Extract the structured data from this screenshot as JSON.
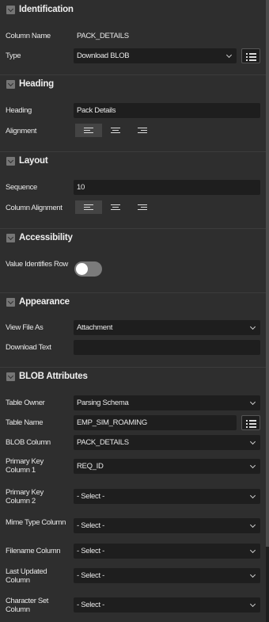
{
  "sections": {
    "identification": "Identification",
    "heading": "Heading",
    "layout": "Layout",
    "accessibility": "Accessibility",
    "appearance": "Appearance",
    "blob": "BLOB Attributes"
  },
  "identification": {
    "column_name_label": "Column Name",
    "column_name_value": "PACK_DETAILS",
    "type_label": "Type",
    "type_value": "Download BLOB"
  },
  "heading": {
    "heading_label": "Heading",
    "heading_value": "Pack Details",
    "alignment_label": "Alignment",
    "alignment_selected": "left"
  },
  "layout": {
    "sequence_label": "Sequence",
    "sequence_value": "10",
    "column_alignment_label": "Column Alignment",
    "column_alignment_selected": "left"
  },
  "accessibility": {
    "value_identifies_row_label": "Value Identifies Row",
    "value_identifies_row_on": false
  },
  "appearance": {
    "view_file_as_label": "View File As",
    "view_file_as_value": "Attachment",
    "download_text_label": "Download Text",
    "download_text_value": ""
  },
  "blob": {
    "table_owner_label": "Table Owner",
    "table_owner_value": "Parsing Schema",
    "table_name_label": "Table Name",
    "table_name_value": "EMP_SIM_ROAMING",
    "blob_column_label": "BLOB Column",
    "blob_column_value": "PACK_DETAILS",
    "pk1_label": "Primary Key Column 1",
    "pk1_value": "REQ_ID",
    "pk2_label": "Primary Key Column 2",
    "pk2_value": "- Select -",
    "mime_label": "Mime Type Column",
    "mime_value": "- Select -",
    "filename_label": "Filename Column",
    "filename_value": "- Select -",
    "last_updated_label": "Last Updated Column",
    "last_updated_value": "- Select -",
    "charset_label": "Character Set Column",
    "charset_value": "- Select -"
  },
  "icons": {
    "section_toggle": "chevron-down-icon",
    "list_button": "list-icon",
    "align_left": "align-left-icon",
    "align_center": "align-center-icon",
    "align_right": "align-right-icon"
  }
}
